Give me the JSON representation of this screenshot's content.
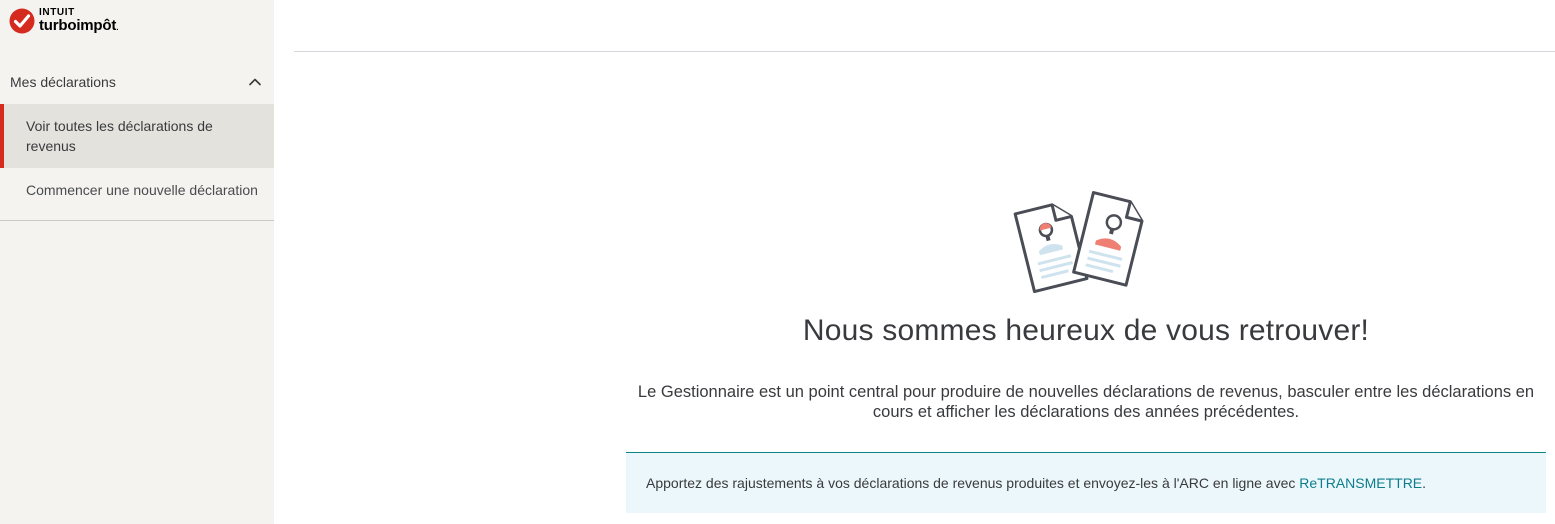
{
  "brand": {
    "company": "INTUIT",
    "product": "turboimpôt",
    "product_suffix": ".",
    "accent_color": "#d52b1e"
  },
  "sidebar": {
    "section_title": "Mes déclarations",
    "section_expanded": true,
    "items": [
      {
        "label": "Voir toutes les déclarations de revenus",
        "active": true
      },
      {
        "label": "Commencer une nouvelle déclaration",
        "active": false
      }
    ]
  },
  "main": {
    "illustration": "tax-documents-illustration",
    "heading": "Nous sommes heureux de vous retrouver!",
    "body": "Le Gestionnaire est un point central pour produire de nouvelles déclarations de revenus, basculer entre les déclarations en cours et afficher les déclarations des années précédentes.",
    "banner": {
      "text_before": "Apportez des rajustements à vos déclarations de revenus produites et envoyez-les à l'ARC en ligne avec ",
      "link_text": "ReTRANSMETTRE",
      "text_after": ".",
      "background": "#ecf7fb",
      "link_color": "#0d7d8c"
    }
  }
}
